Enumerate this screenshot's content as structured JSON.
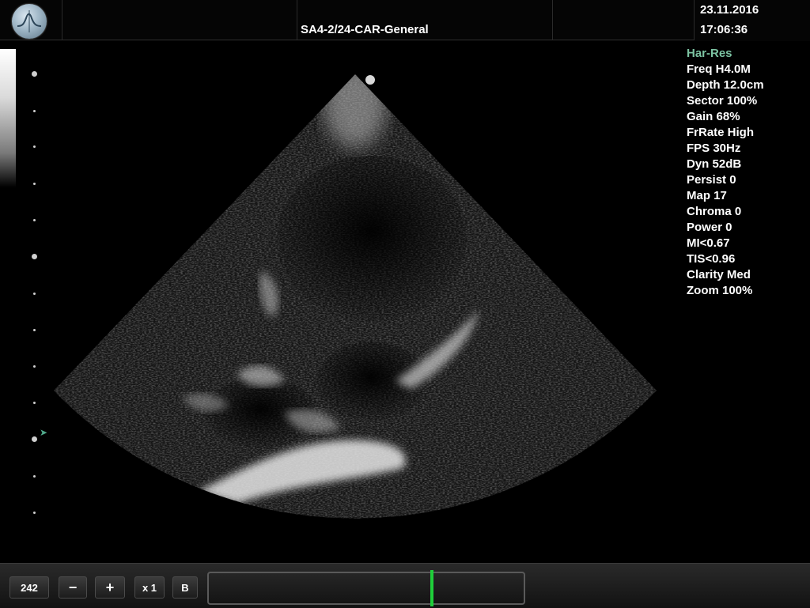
{
  "header": {
    "preset": "SA4-2/24-CAR-General",
    "date": "23.11.2016",
    "time": "17:06:36"
  },
  "params": [
    {
      "text": "Har-Res",
      "mode": true
    },
    {
      "text": "Freq H4.0M"
    },
    {
      "text": "Depth 12.0cm"
    },
    {
      "text": "Sector 100%"
    },
    {
      "text": "Gain 68%"
    },
    {
      "text": "FrRate High"
    },
    {
      "text": "FPS 30Hz"
    },
    {
      "text": "Dyn 52dB"
    },
    {
      "text": "Persist 0"
    },
    {
      "text": "Map 17"
    },
    {
      "text": "Chroma 0"
    },
    {
      "text": "Power 0"
    },
    {
      "text": "MI<0.67"
    },
    {
      "text": "TIS<0.96"
    },
    {
      "text": "Clarity Med"
    },
    {
      "text": "Zoom 100%"
    }
  ],
  "toolbar": {
    "frame_count": "242",
    "minus_label": "−",
    "plus_label": "+",
    "speed_label": "x 1",
    "mode_label": "B"
  },
  "cine": {
    "position_fraction": 0.71
  },
  "colors": {
    "mode_label": "#7cc3a2",
    "cine_cursor": "#1fcf3a",
    "focus_marker": "#4fa88a"
  },
  "icons": {
    "logo": "waveform-logo-icon",
    "focus": "focus-marker-icon"
  }
}
